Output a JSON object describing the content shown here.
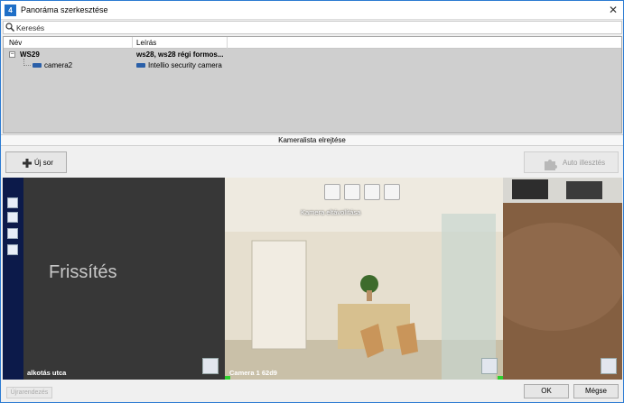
{
  "window": {
    "title": "Panoráma szerkesztése",
    "close_icon": "close-icon",
    "app_icon_glyph": "4"
  },
  "search": {
    "placeholder": "Keresés"
  },
  "camera_list": {
    "columns": [
      "Név",
      "Leírás"
    ],
    "rows": [
      {
        "name": "WS29",
        "description": "ws28, ws28 régi formos...",
        "level": 0,
        "expanded": true
      },
      {
        "name": "camera2",
        "description": "Intellio security camera",
        "level": 1
      }
    ]
  },
  "hide_camera_list_label": "Kameralista elrejtése",
  "toolbar": {
    "new_row_label": "Új sor",
    "auto_fit_label": "Auto illesztés"
  },
  "panorama": {
    "refresh_label": "Frissítés",
    "cam1_label": "alkotás utca",
    "cam2_label": "Camera 1 62d9",
    "remove_camera_label": "Kamera eltávolítása"
  },
  "footer": {
    "disabled_button_label": "Újrarendezés",
    "ok_label": "OK",
    "cancel_label": "Mégse"
  },
  "colors": {
    "accent": "#2b7bd2",
    "list_background": "#cfcfcf",
    "marker_green": "#2ed02e"
  }
}
